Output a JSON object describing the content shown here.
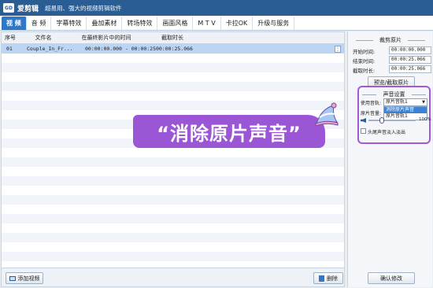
{
  "titlebar": {
    "logo_text": "GD",
    "app_name": "爱剪辑",
    "slogan": "超易用、强大的视频剪辑软件"
  },
  "tabs": [
    {
      "label": "视 频",
      "active": true
    },
    {
      "label": "音 频"
    },
    {
      "label": "字幕特效"
    },
    {
      "label": "叠加素材"
    },
    {
      "label": "转场特效"
    },
    {
      "label": "画面风格"
    },
    {
      "label": "M T V"
    },
    {
      "label": "卡拉OK"
    },
    {
      "label": "升级与服务"
    }
  ],
  "list": {
    "headers": {
      "index": "序号",
      "name": "文件名",
      "start": "在最终影片中的时间",
      "duration": "截取时长"
    },
    "row": {
      "index": "01",
      "name": "Couple_In_Fr...",
      "start": "00:00:00.000 - 00:00:25.066",
      "duration": "00:00:25.066",
      "menu": "⋮"
    }
  },
  "bottom": {
    "add_label": "添加视频",
    "delete_label": "删除"
  },
  "clip_panel": {
    "title": "裁剪原片",
    "start_label": "开始时间:",
    "start_value": "00:00:00.000",
    "end_label": "结束时间:",
    "end_value": "00:00:25.066",
    "dur_label": "截取时长:",
    "dur_value": "00:00:25.066",
    "preview_label": "预览/截取原片"
  },
  "audio_panel": {
    "title": "声音设置",
    "track_label": "使用音轨:",
    "track_value": "原片音轨1",
    "options": [
      "消除原片声音",
      "原片音轨1"
    ],
    "volume_label": "原片音量:",
    "volume_value": "100%",
    "fade_label": "头尾声音淡入淡出"
  },
  "confirm_label": "确认修改",
  "callout": {
    "text": "“消除原片声音”"
  },
  "colors": {
    "titlebar": "#2a5d93",
    "tab_active": "#2f77c7",
    "highlight": "#a259d9",
    "row_selected": "#bcd5f2"
  }
}
